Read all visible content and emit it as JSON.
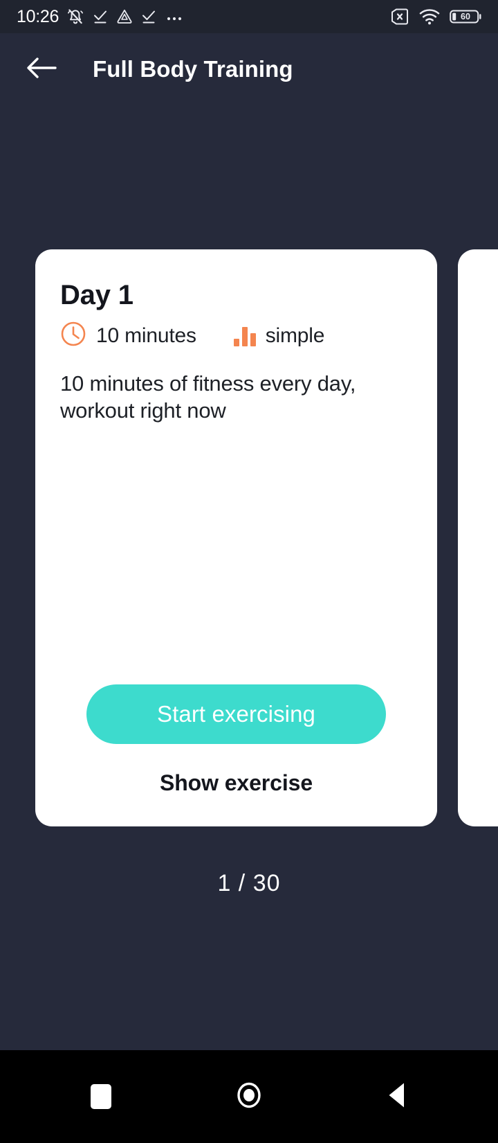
{
  "status_bar": {
    "clock": "10:26",
    "left_icons": [
      "bell-muted-icon",
      "check-underline-icon",
      "triangle-drive-icon",
      "check-underline-icon",
      "more-overflow-icon"
    ],
    "right_icons": [
      "sim-card-x-icon",
      "wifi-icon"
    ],
    "battery_level": "60"
  },
  "app_bar": {
    "back_icon": "arrow-left-icon",
    "title": "Full Body Training"
  },
  "card": {
    "day_title": "Day 1",
    "duration_icon": "clock-icon",
    "duration": "10 minutes",
    "difficulty_icon": "bar-chart-icon",
    "difficulty": "simple",
    "description": "10 minutes of fitness every day, workout right now",
    "primary_button": "Start exercising",
    "secondary_button": "Show exercise"
  },
  "pager": {
    "indicator": "1 / 30",
    "current": "1",
    "total": "30"
  },
  "nav_bar": {
    "recents_icon": "square-recents-icon",
    "home_icon": "circle-home-icon",
    "back_icon": "triangle-back-icon"
  },
  "colors": {
    "background": "#262a3b",
    "status_bar": "#20242f",
    "card": "#ffffff",
    "accent_teal": "#3ddbcd",
    "accent_orange": "#f4854f",
    "nav_bar": "#000000",
    "text_light": "#ffffff",
    "text_dark": "#14161d"
  }
}
